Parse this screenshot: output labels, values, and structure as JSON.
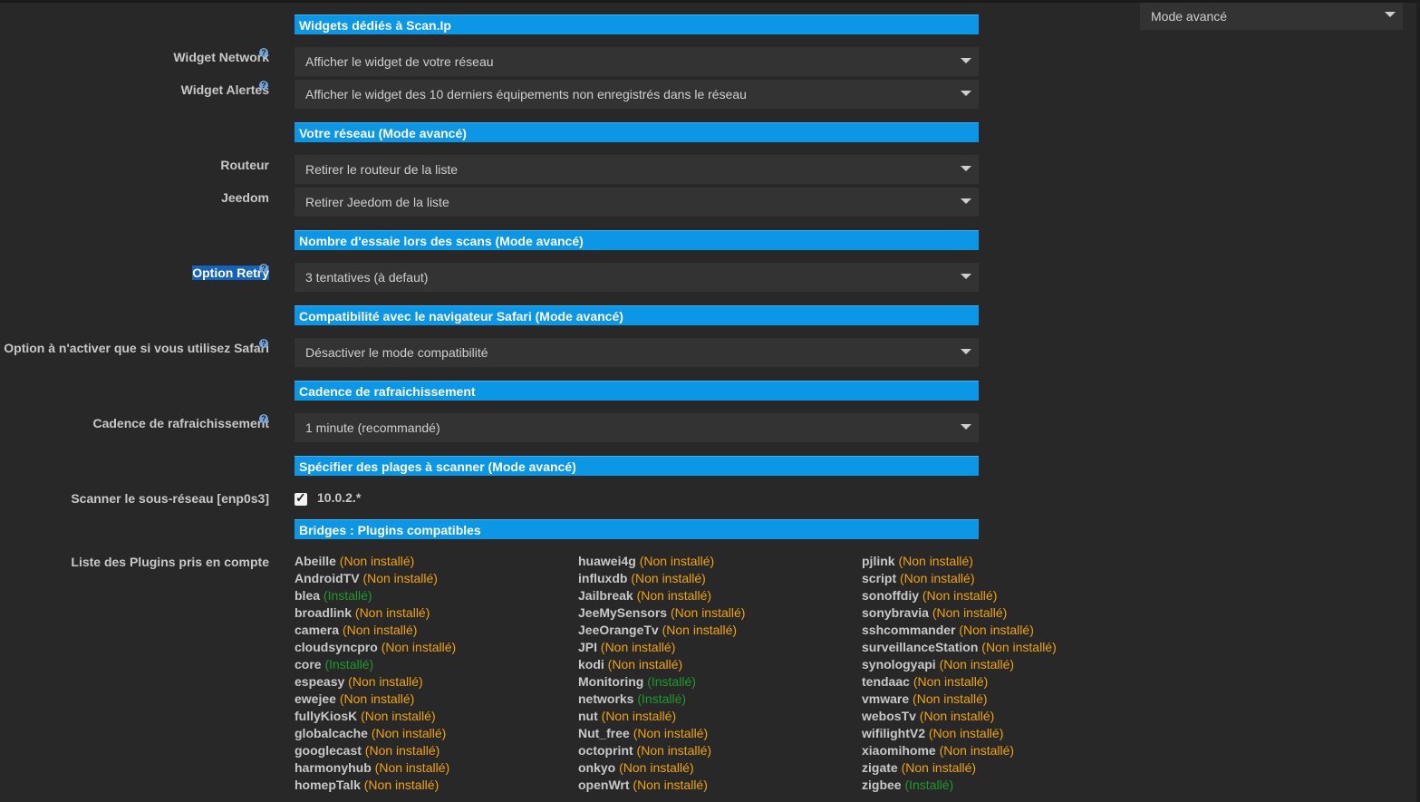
{
  "mode_select": {
    "value": "Mode avancé"
  },
  "sections": {
    "widgets": "Widgets dédiés à Scan.Ip",
    "network": "Votre réseau (Mode avancé)",
    "retry": "Nombre d'essaie lors des scans (Mode avancé)",
    "safari": "Compatibilité avec le navigateur Safari (Mode avancé)",
    "refresh": "Cadence de rafraichissement",
    "ranges": "Spécifier des plages à scanner (Mode avancé)",
    "bridges": "Bridges : Plugins compatibles"
  },
  "fields": {
    "widget_network": {
      "label": "Widget Network",
      "value": "Afficher le widget de votre réseau"
    },
    "widget_alertes": {
      "label": "Widget Alertes",
      "value": "Afficher le widget des 10 derniers équipements non enregistrés dans le réseau"
    },
    "routeur": {
      "label": "Routeur",
      "value": "Retirer le routeur de la liste"
    },
    "jeedom": {
      "label": "Jeedom",
      "value": "Retirer Jeedom de la liste"
    },
    "retry": {
      "label": "Option Retry",
      "value": "3 tentatives (à defaut)"
    },
    "safari": {
      "label": "Option à n'activer que si vous utilisez Safari",
      "value": "Désactiver le mode compatibilité"
    },
    "refresh": {
      "label": "Cadence de rafraichissement",
      "value": "1 minute (recommandé)"
    },
    "subnet": {
      "label": "Scanner le sous-réseau [enp0s3]",
      "value": "10.0.2.*"
    },
    "plugins_label": "Liste des Plugins pris en compte"
  },
  "status": {
    "not_installed": "(Non installé)",
    "installed": "(Installé)"
  },
  "plugins": {
    "col1": [
      {
        "name": "Abeille",
        "installed": false
      },
      {
        "name": "AndroidTV",
        "installed": false
      },
      {
        "name": "blea",
        "installed": true
      },
      {
        "name": "broadlink",
        "installed": false
      },
      {
        "name": "camera",
        "installed": false
      },
      {
        "name": "cloudsyncpro",
        "installed": false
      },
      {
        "name": "core",
        "installed": true
      },
      {
        "name": "espeasy",
        "installed": false
      },
      {
        "name": "ewejee",
        "installed": false
      },
      {
        "name": "fullyKiosK",
        "installed": false
      },
      {
        "name": "globalcache",
        "installed": false
      },
      {
        "name": "googlecast",
        "installed": false
      },
      {
        "name": "harmonyhub",
        "installed": false
      },
      {
        "name": "homepTalk",
        "installed": false
      }
    ],
    "col2": [
      {
        "name": "huawei4g",
        "installed": false
      },
      {
        "name": "influxdb",
        "installed": false
      },
      {
        "name": "Jailbreak",
        "installed": false
      },
      {
        "name": "JeeMySensors",
        "installed": false
      },
      {
        "name": "JeeOrangeTv",
        "installed": false
      },
      {
        "name": "JPI",
        "installed": false
      },
      {
        "name": "kodi",
        "installed": false
      },
      {
        "name": "Monitoring",
        "installed": true
      },
      {
        "name": "networks",
        "installed": true
      },
      {
        "name": "nut",
        "installed": false
      },
      {
        "name": "Nut_free",
        "installed": false
      },
      {
        "name": "octoprint",
        "installed": false
      },
      {
        "name": "onkyo",
        "installed": false
      },
      {
        "name": "openWrt",
        "installed": false
      }
    ],
    "col3": [
      {
        "name": "pjlink",
        "installed": false
      },
      {
        "name": "script",
        "installed": false
      },
      {
        "name": "sonoffdiy",
        "installed": false
      },
      {
        "name": "sonybravia",
        "installed": false
      },
      {
        "name": "sshcommander",
        "installed": false
      },
      {
        "name": "surveillanceStation",
        "installed": false
      },
      {
        "name": "synologyapi",
        "installed": false
      },
      {
        "name": "tendaac",
        "installed": false
      },
      {
        "name": "vmware",
        "installed": false
      },
      {
        "name": "webosTv",
        "installed": false
      },
      {
        "name": "wifilightV2",
        "installed": false
      },
      {
        "name": "xiaomihome",
        "installed": false
      },
      {
        "name": "zigate",
        "installed": false
      },
      {
        "name": "zigbee",
        "installed": true
      }
    ]
  }
}
